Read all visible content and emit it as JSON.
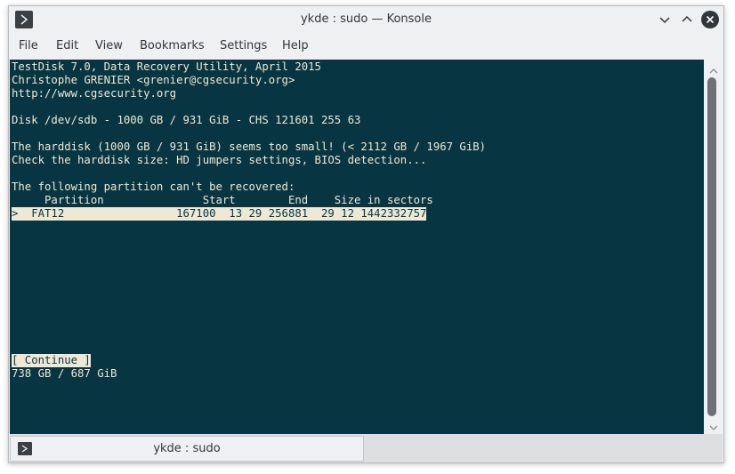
{
  "window": {
    "title": "ykde : sudo — Konsole"
  },
  "menu": {
    "items": [
      "File",
      "Edit",
      "View",
      "Bookmarks",
      "Settings",
      "Help"
    ]
  },
  "terminal": {
    "lines": [
      "TestDisk 7.0, Data Recovery Utility, April 2015",
      "Christophe GRENIER <grenier@cgsecurity.org>",
      "http://www.cgsecurity.org",
      "",
      "Disk /dev/sdb - 1000 GB / 931 GiB - CHS 121601 255 63",
      "",
      "The harddisk (1000 GB / 931 GiB) seems too small! (< 2112 GB / 1967 GiB)",
      "Check the harddisk size: HD jumpers settings, BIOS detection...",
      "",
      "The following partition can't be recovered:",
      "     Partition               Start        End    Size in sectors"
    ],
    "selected_row": ">  FAT12                 167100  13 29 256881  29 12 1442332757",
    "continue_button": "[ Continue ]",
    "size_line": "738 GB / 687 GiB"
  },
  "tab": {
    "label": "ykde : sudo"
  },
  "colors": {
    "terminal_bg": "#073642",
    "terminal_fg": "#eee8d5"
  }
}
